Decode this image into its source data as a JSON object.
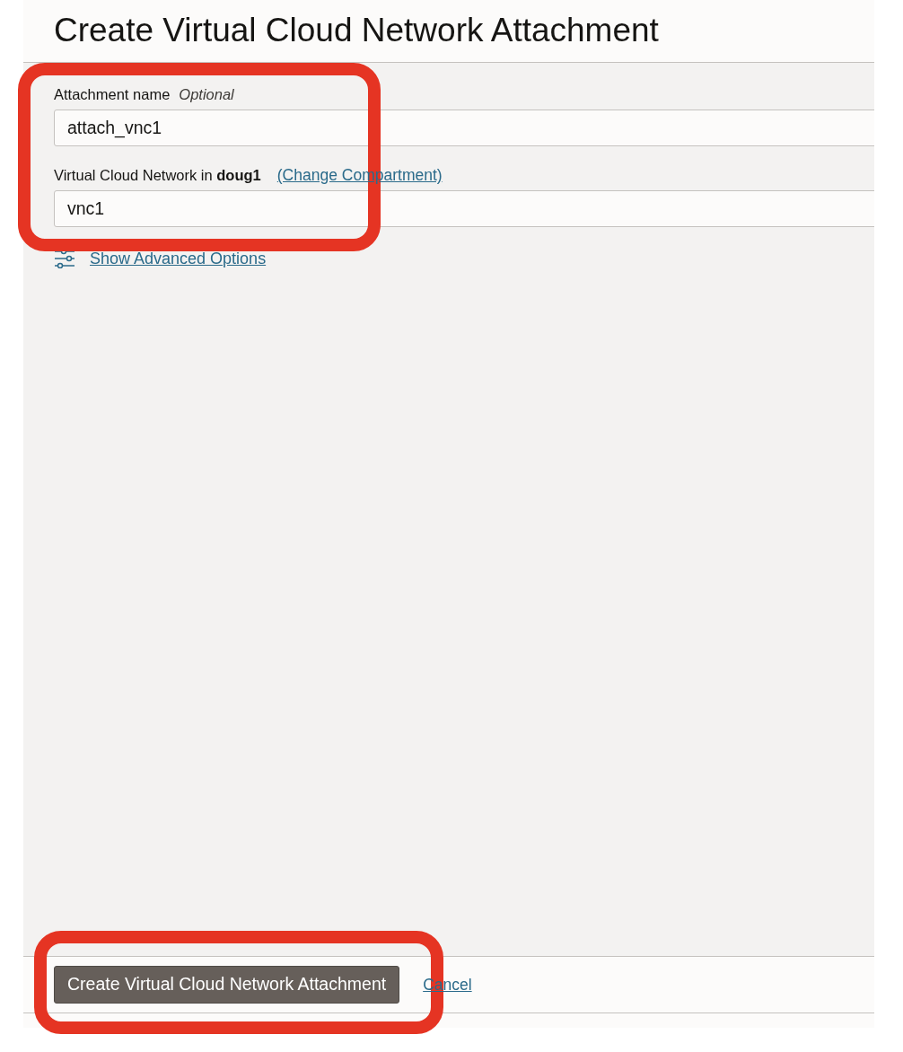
{
  "title": "Create Virtual Cloud Network Attachment",
  "fields": [
    {
      "label": "Attachment name",
      "hint": "Optional",
      "value": "attach_vnc1"
    },
    {
      "label": "Virtual Cloud Network in **doug1**",
      "link": "(Change Compartment)",
      "value": "vnc1"
    }
  ],
  "advanced_link": "Show Advanced Options",
  "footer": {
    "primary_button": "Create Virtual Cloud Network Attachment",
    "cancel_link": "Cancel"
  }
}
